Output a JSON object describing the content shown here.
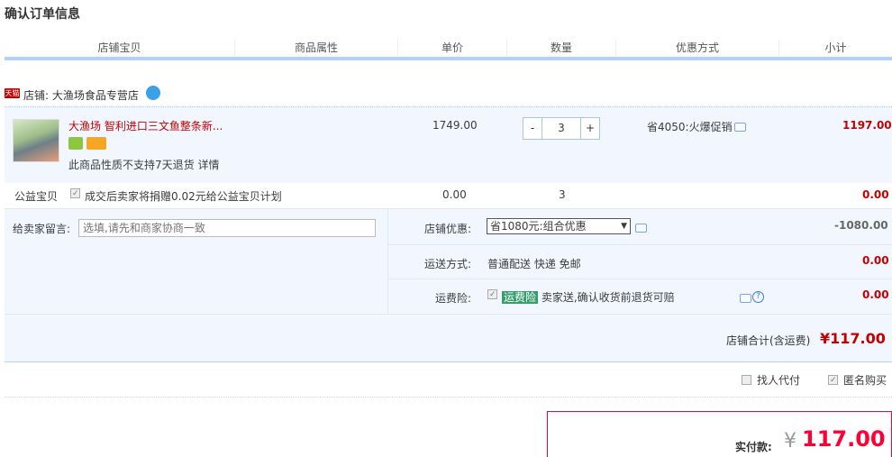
{
  "page": {
    "title": "确认订单信息"
  },
  "columns": [
    "店铺宝贝",
    "商品属性",
    "单价",
    "数量",
    "优惠方式",
    "小计"
  ],
  "shop": {
    "badge": "天猫",
    "label": "店铺: 大渔场食品专营店"
  },
  "item": {
    "name": "大渔场 智利进口三文鱼整条新...",
    "return_note": "此商品性质不支持7天退货 详情",
    "price": "1749.00",
    "qty": "3",
    "qty_minus": "-",
    "qty_plus": "+",
    "promo": "省4050:火爆促销",
    "subtotal": "1197.00"
  },
  "charity": {
    "label": "公益宝贝",
    "text": "成交后卖家将捐赠0.02元给公益宝贝计划",
    "price": "0.00",
    "qty": "3",
    "subtotal": "0.00"
  },
  "message": {
    "label": "给卖家留言:",
    "placeholder": "选填,请先和商家协商一致"
  },
  "shop_discount": {
    "label": "店铺优惠:",
    "selected": "省1080元:组合优惠",
    "amount": "-1080.00"
  },
  "shipping": {
    "label": "运送方式:",
    "value": "普通配送 快递 免邮",
    "amount": "0.00"
  },
  "insurance": {
    "label": "运费险:",
    "tag": "运费险",
    "text": "卖家送,确认收货前退货可赔",
    "amount": "0.00"
  },
  "shop_total": {
    "label": "店铺合计(含运费)",
    "value": "¥117.00"
  },
  "options": {
    "proxy_pay": "找人代付",
    "anonymous": "匿名购买"
  },
  "payment": {
    "label": "实付款:",
    "currency": "¥",
    "value": "117.00"
  },
  "colors": {
    "accent": "#ff0036",
    "price_red": "#c40000",
    "row_bg": "#f2f7ff"
  }
}
